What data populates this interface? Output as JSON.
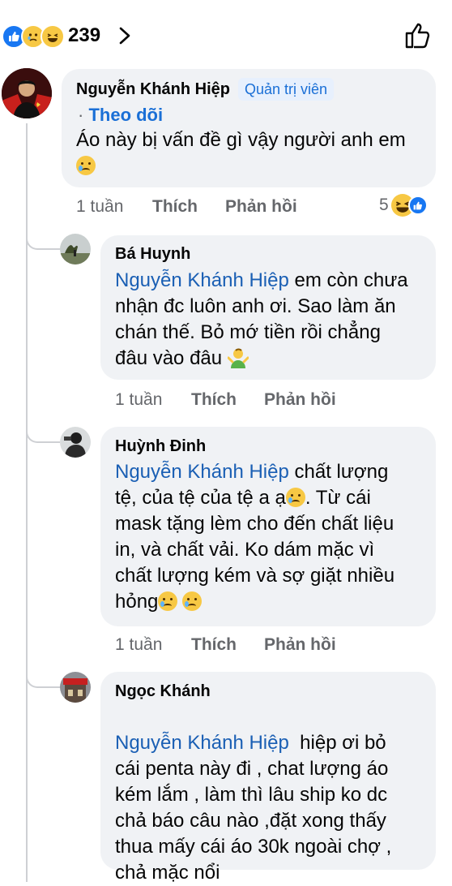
{
  "reactions": {
    "count": "239",
    "icons": [
      "like-icon",
      "sad-icon",
      "haha-icon"
    ]
  },
  "comments": [
    {
      "author": "Nguyễn Khánh Hiệp",
      "badge": "Quản trị viên",
      "follow": "Theo dõi",
      "follow_prefix": "·",
      "text": "Áo này bị vấn đề gì vậy người anh em",
      "time": "1 tuần",
      "like": "Thích",
      "reply": "Phản hồi",
      "reaction_count": "5"
    }
  ],
  "replies": [
    {
      "author": "Bá Huynh",
      "mention": "Nguyễn Khánh Hiệp",
      "line1_rest": " em còn chưa",
      "line2": "nhận đc luôn anh ơi. Sao làm ăn",
      "line3": "chán thế. Bỏ mớ tiền rồi chẳng",
      "line4": "đâu vào đâu",
      "time": "1 tuần",
      "like": "Thích",
      "reply": "Phản hồi"
    },
    {
      "author": "Huỳnh Đinh",
      "mention": "Nguyễn Khánh Hiệp",
      "line1_rest": " chất lượng",
      "line2": "tệ, của tệ của tệ a ạ",
      "line2_rest": ". Từ cái",
      "line3": "mask tặng lèm cho đến chất liệu",
      "line4": "in, và chất vải. Ko dám mặc vì",
      "line5": "chất lượng kém và sợ giặt nhiều",
      "line6": "hỏng",
      "time": "1 tuần",
      "like": "Thích",
      "reply": "Phản hồi"
    },
    {
      "author": "Ngọc Khánh",
      "mention": "Nguyễn Khánh Hiệp",
      "line1_rest": "  hiệp ơi bỏ",
      "line2": "cái penta này đi , chat lượng áo",
      "line3": "kém lắm , làm thì lâu ship ko dc",
      "line4": "chả báo câu nào ,đặt xong thấy",
      "line5": "thua mấy cái áo 30k ngoài chợ ,",
      "line6": "chả mặc nổi"
    }
  ],
  "colors": {
    "link": "#1a5fb4",
    "bubble": "#f0f2f5",
    "muted": "#65676b",
    "accent": "#1877f2"
  }
}
